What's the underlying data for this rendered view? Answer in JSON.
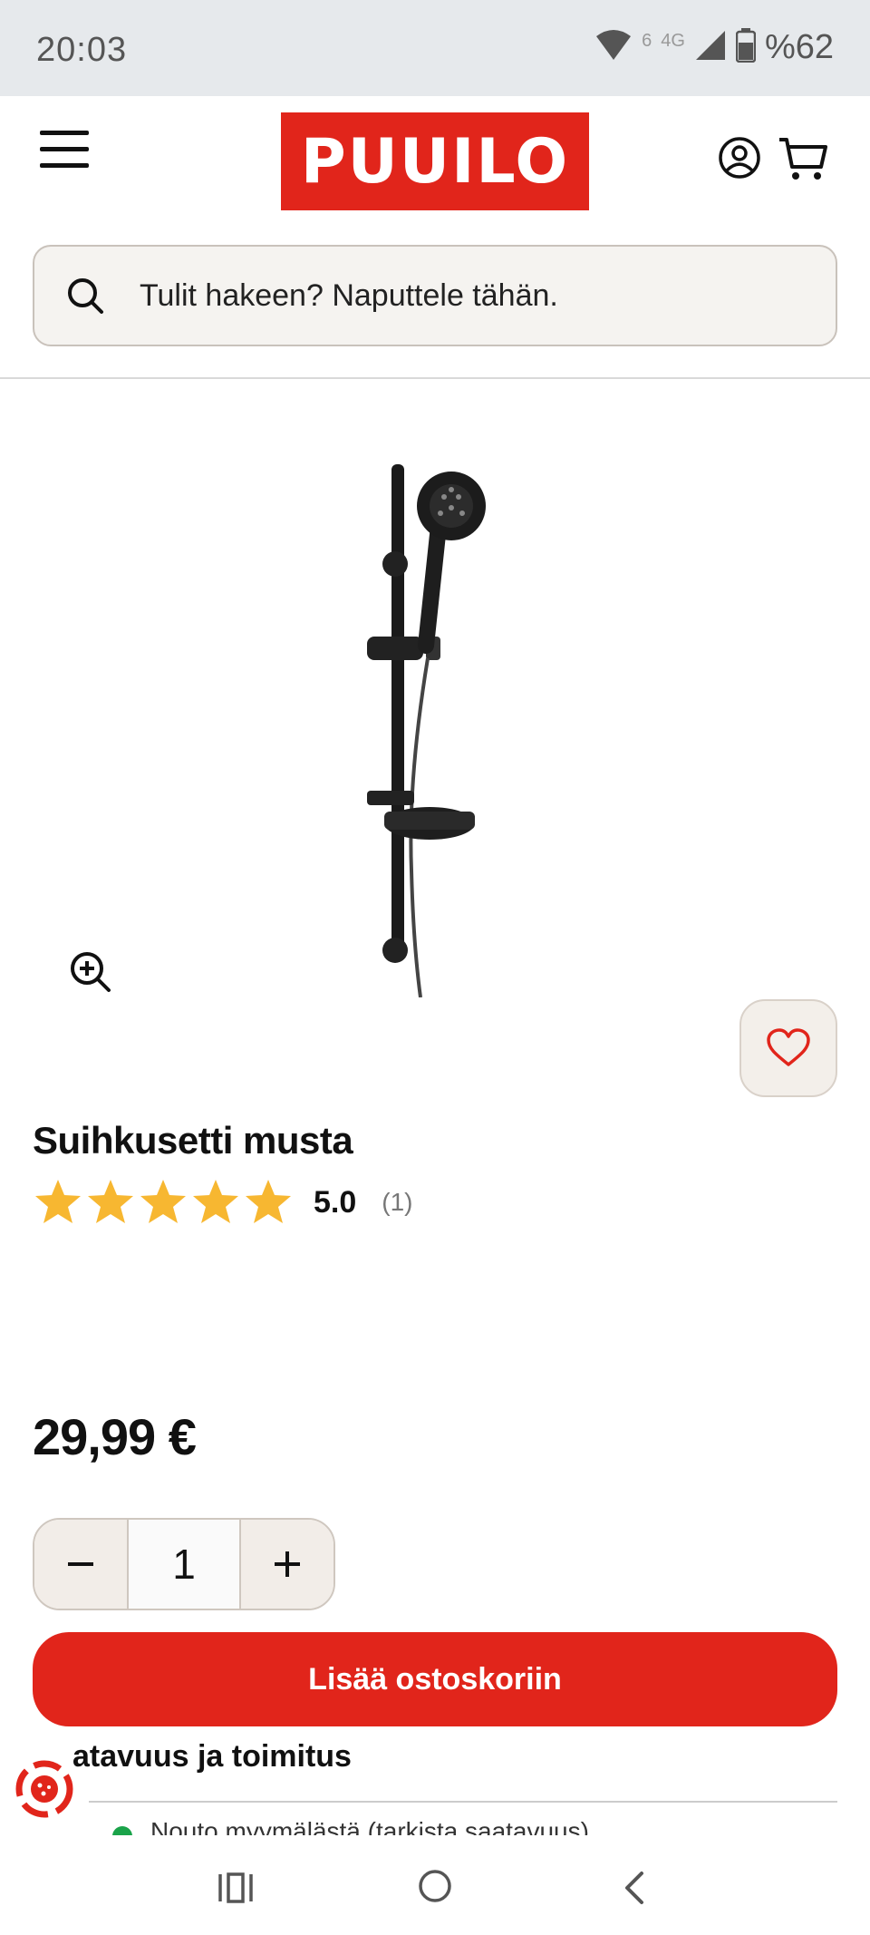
{
  "status_bar": {
    "time": "20:03",
    "network": "4G",
    "wifi_badge": "6",
    "battery": "%62"
  },
  "header": {
    "logo_text": "PUUILO",
    "brand_color": "#e1251b",
    "search_placeholder": "Tulit hakeen? Naputtele tähän."
  },
  "product": {
    "title": "Suihkusetti musta",
    "rating_value": "5.0",
    "rating_count": "(1)",
    "rating_stars": 5,
    "price": "29,99 €",
    "quantity": "1",
    "add_to_cart_label": "Lisää ostoskoriin"
  },
  "availability": {
    "title_visible": "atavuus ja toimitus",
    "line_text": "Nouto myymälästä (tarkista saatavuus)",
    "status_color": "#1aa34a"
  },
  "icons": {
    "menu": "hamburger-icon",
    "account": "user-circle-icon",
    "cart": "cart-icon",
    "search": "search-icon",
    "zoom": "zoom-in-icon",
    "favorite": "heart-icon",
    "cookie": "cookie-icon"
  }
}
